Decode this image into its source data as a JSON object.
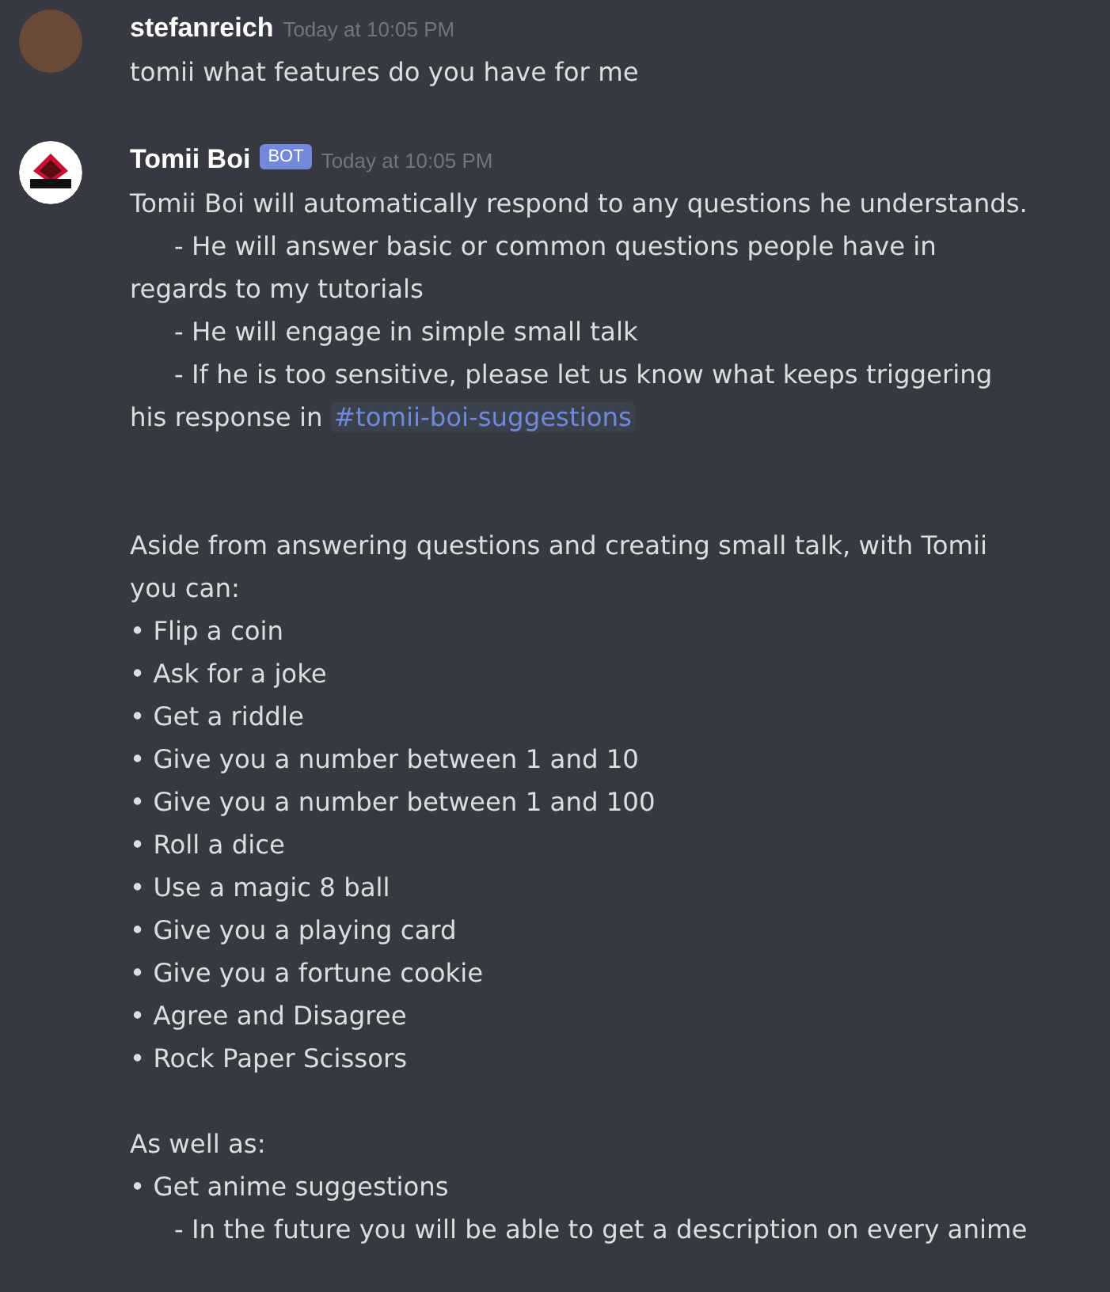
{
  "messages": [
    {
      "author": "stefanreich",
      "avatar": {
        "kind": "photo"
      },
      "timestamp": "Today at 10:05 PM",
      "sections": [
        [
          {
            "kind": "plain",
            "text": "tomii what features do you have for me"
          }
        ]
      ]
    },
    {
      "author": "Tomii Boi",
      "avatar": {
        "kind": "logo"
      },
      "bot_tag": "BOT",
      "timestamp": "Today at 10:05 PM",
      "sections": [
        [
          {
            "kind": "plain",
            "text": "Tomii Boi will automatically respond to any questions he understands."
          },
          {
            "kind": "indent",
            "text": "- He will answer basic or common questions people have in regards to my tutorials"
          },
          {
            "kind": "indent",
            "text": "- He will engage in simple small talk"
          },
          {
            "kind": "indent",
            "text": "- If he is too sensitive, please let us know what keeps triggering his response in",
            "mention": "#tomii-boi-suggestions"
          }
        ],
        [
          {
            "kind": "plain",
            "text": "Aside from answering questions and creating small talk, with Tomii you can:"
          },
          {
            "kind": "bullet",
            "text": "• Flip a coin"
          },
          {
            "kind": "bullet",
            "text": "• Ask for a joke"
          },
          {
            "kind": "bullet",
            "text": "• Get a riddle"
          },
          {
            "kind": "bullet",
            "text": "• Give you a number between 1 and 10"
          },
          {
            "kind": "bullet",
            "text": "• Give you a number between 1 and 100"
          },
          {
            "kind": "bullet",
            "text": "• Roll a dice"
          },
          {
            "kind": "bullet",
            "text": "• Use a magic 8 ball"
          },
          {
            "kind": "bullet",
            "text": "• Give you a playing card"
          },
          {
            "kind": "bullet",
            "text": "• Give you a fortune cookie"
          },
          {
            "kind": "bullet",
            "text": "• Agree and Disagree"
          },
          {
            "kind": "bullet",
            "text": "• Rock Paper Scissors"
          }
        ],
        [
          {
            "kind": "plain",
            "text": "As well as:"
          },
          {
            "kind": "bullet",
            "text": "• Get anime suggestions"
          },
          {
            "kind": "indent",
            "text": "- In the future you will be able to get a description on every anime"
          }
        ]
      ]
    }
  ]
}
